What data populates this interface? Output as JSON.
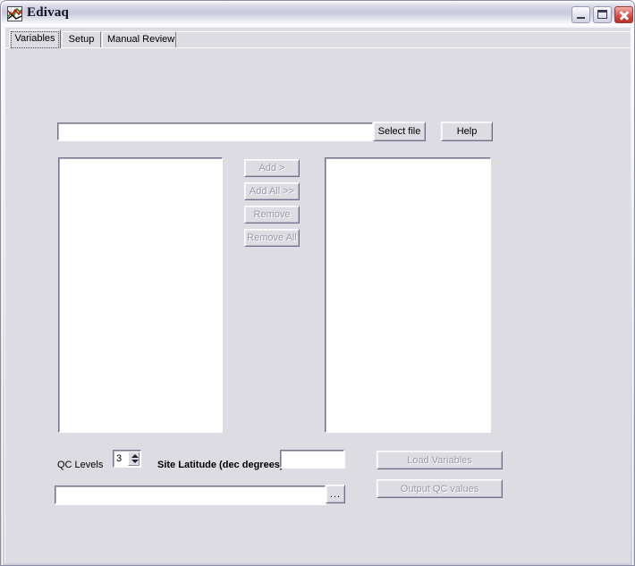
{
  "window": {
    "title": "Edivaq",
    "icon": "chart-icon",
    "controls": {
      "minimize": "minimize-icon",
      "maximize": "maximize-icon",
      "close": "close-icon"
    }
  },
  "tabs": [
    {
      "label": "Variables",
      "selected": true
    },
    {
      "label": "Setup",
      "selected": false
    },
    {
      "label": "Manual Review",
      "selected": false
    }
  ],
  "file_row": {
    "path_value": "",
    "select_file_label": "Select file",
    "help_label": "Help"
  },
  "lists": {
    "available": {
      "items": []
    },
    "selected": {
      "items": []
    }
  },
  "transfer_buttons": [
    {
      "label": "Add >",
      "enabled": false
    },
    {
      "label": "Add All >>",
      "enabled": false
    },
    {
      "label": "Remove",
      "enabled": false
    },
    {
      "label": "Remove All",
      "enabled": false
    }
  ],
  "options": {
    "qc_levels_label": "QC Levels",
    "qc_levels_value": "3",
    "site_latitude_label": "Site Latitude (dec degrees)",
    "site_latitude_value": "",
    "output_path_value": "",
    "browse_label": "..."
  },
  "action_buttons": [
    {
      "label": "Load Variables",
      "enabled": false
    },
    {
      "label": "Output QC values",
      "enabled": false
    }
  ],
  "colors": {
    "client_background": "#dcdce2",
    "field_background": "#ffffff",
    "disabled_text": "#9a9aa8",
    "close_button": "#cf3f36"
  }
}
